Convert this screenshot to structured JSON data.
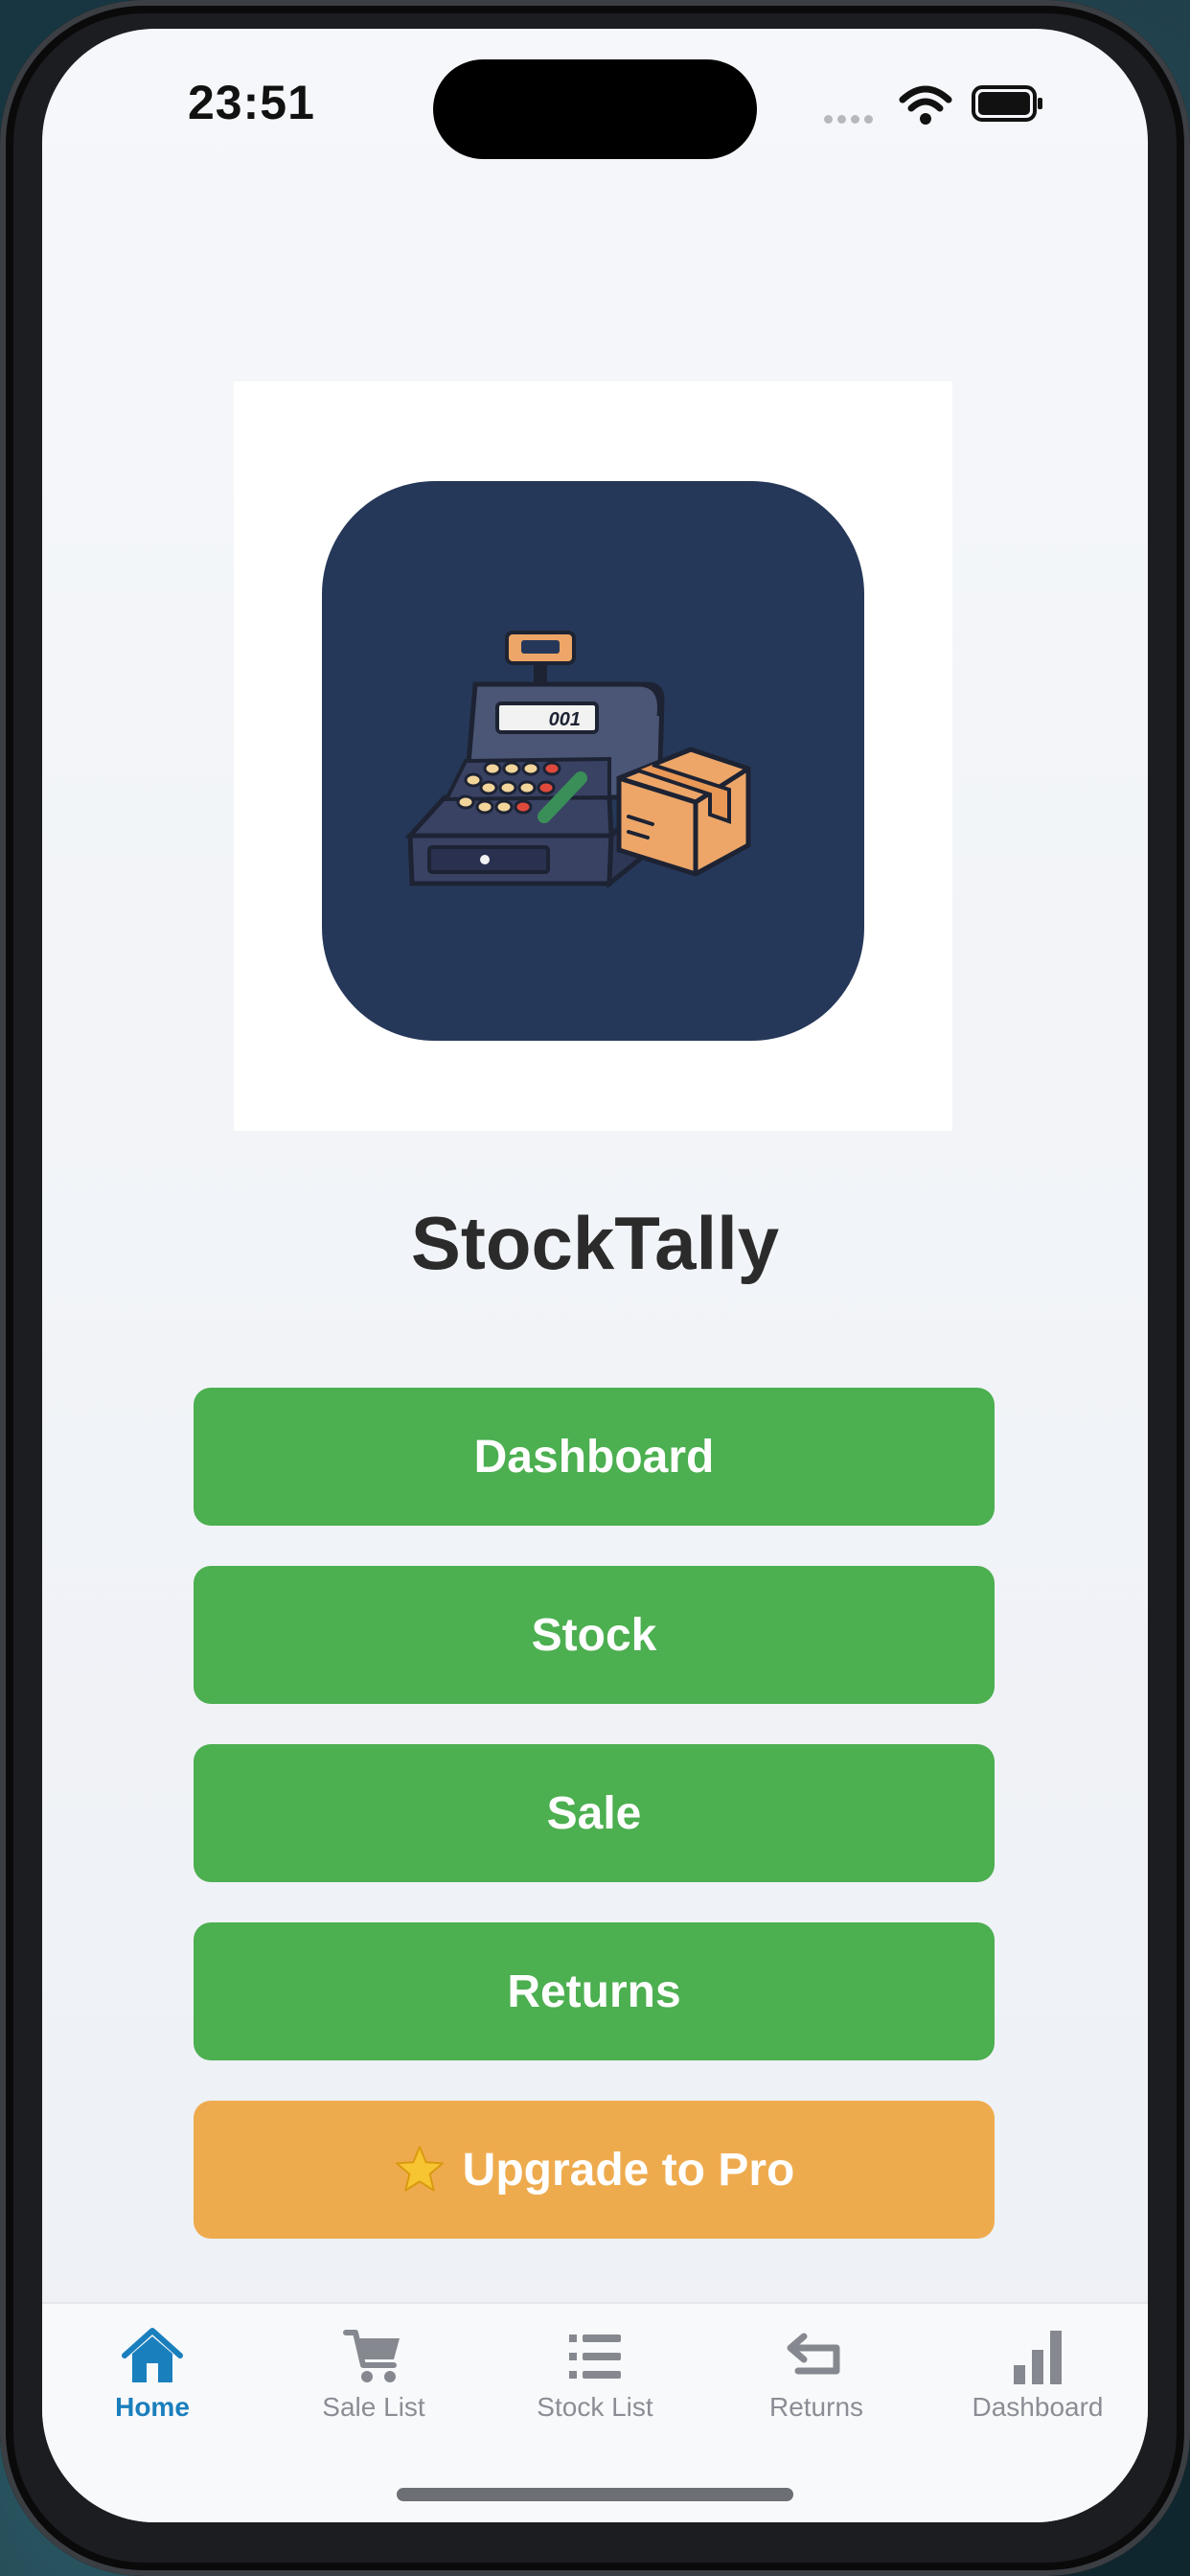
{
  "status_bar": {
    "time": "23:51"
  },
  "app": {
    "title": "StockTally"
  },
  "logo": {
    "register_display": "001"
  },
  "menu": {
    "dashboard_label": "Dashboard",
    "stock_label": "Stock",
    "sale_label": "Sale",
    "returns_label": "Returns",
    "upgrade_label": "Upgrade to Pro"
  },
  "tab_bar": {
    "items": [
      {
        "label": "Home",
        "icon": "home-icon",
        "active": true
      },
      {
        "label": "Sale List",
        "icon": "cart-icon",
        "active": false
      },
      {
        "label": "Stock List",
        "icon": "list-icon",
        "active": false
      },
      {
        "label": "Returns",
        "icon": "return-arrow-icon",
        "active": false
      },
      {
        "label": "Dashboard",
        "icon": "bar-chart-icon",
        "active": false
      }
    ]
  },
  "colors": {
    "primary_button": "#4caf50",
    "upgrade_button": "#eeab4e",
    "active_tab": "#1a7fbd",
    "logo_background": "#263859"
  }
}
